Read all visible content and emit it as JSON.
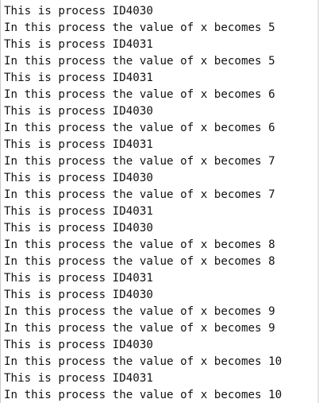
{
  "terminal": {
    "lines": [
      "This is process ID4030",
      "In this process the value of x becomes 5",
      "This is process ID4031",
      "In this process the value of x becomes 5",
      "This is process ID4031",
      "In this process the value of x becomes 6",
      "This is process ID4030",
      "In this process the value of x becomes 6",
      "This is process ID4031",
      "In this process the value of x becomes 7",
      "This is process ID4030",
      "In this process the value of x becomes 7",
      "This is process ID4031",
      "This is process ID4030",
      "In this process the value of x becomes 8",
      "In this process the value of x becomes 8",
      "This is process ID4031",
      "This is process ID4030",
      "In this process the value of x becomes 9",
      "In this process the value of x becomes 9",
      "This is process ID4030",
      "In this process the value of x becomes 10",
      "This is process ID4031",
      "In this process the value of x becomes 10"
    ]
  }
}
